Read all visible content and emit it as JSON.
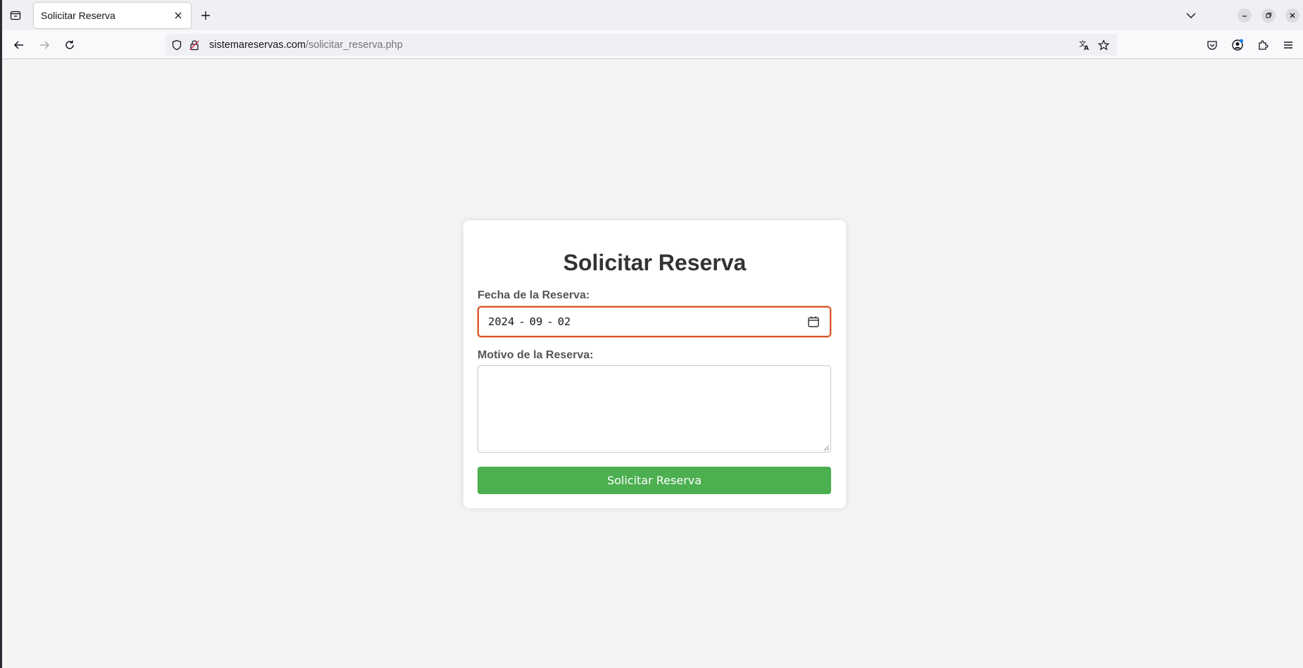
{
  "browser": {
    "tab_title": "Solicitar Reserva",
    "url_host": "sistemareservas.com",
    "url_path": "/solicitar_reserva.php"
  },
  "form": {
    "title": "Solicitar Reserva",
    "date_label": "Fecha de la Reserva:",
    "date_year": "2024",
    "date_month": "09",
    "date_day": "02",
    "date_separator": "-",
    "reason_label": "Motivo de la Reserva:",
    "reason_value": "",
    "submit_label": "Solicitar Reserva"
  },
  "colors": {
    "submit_button": "#4caf50",
    "date_focus_border": "#d9542b"
  }
}
